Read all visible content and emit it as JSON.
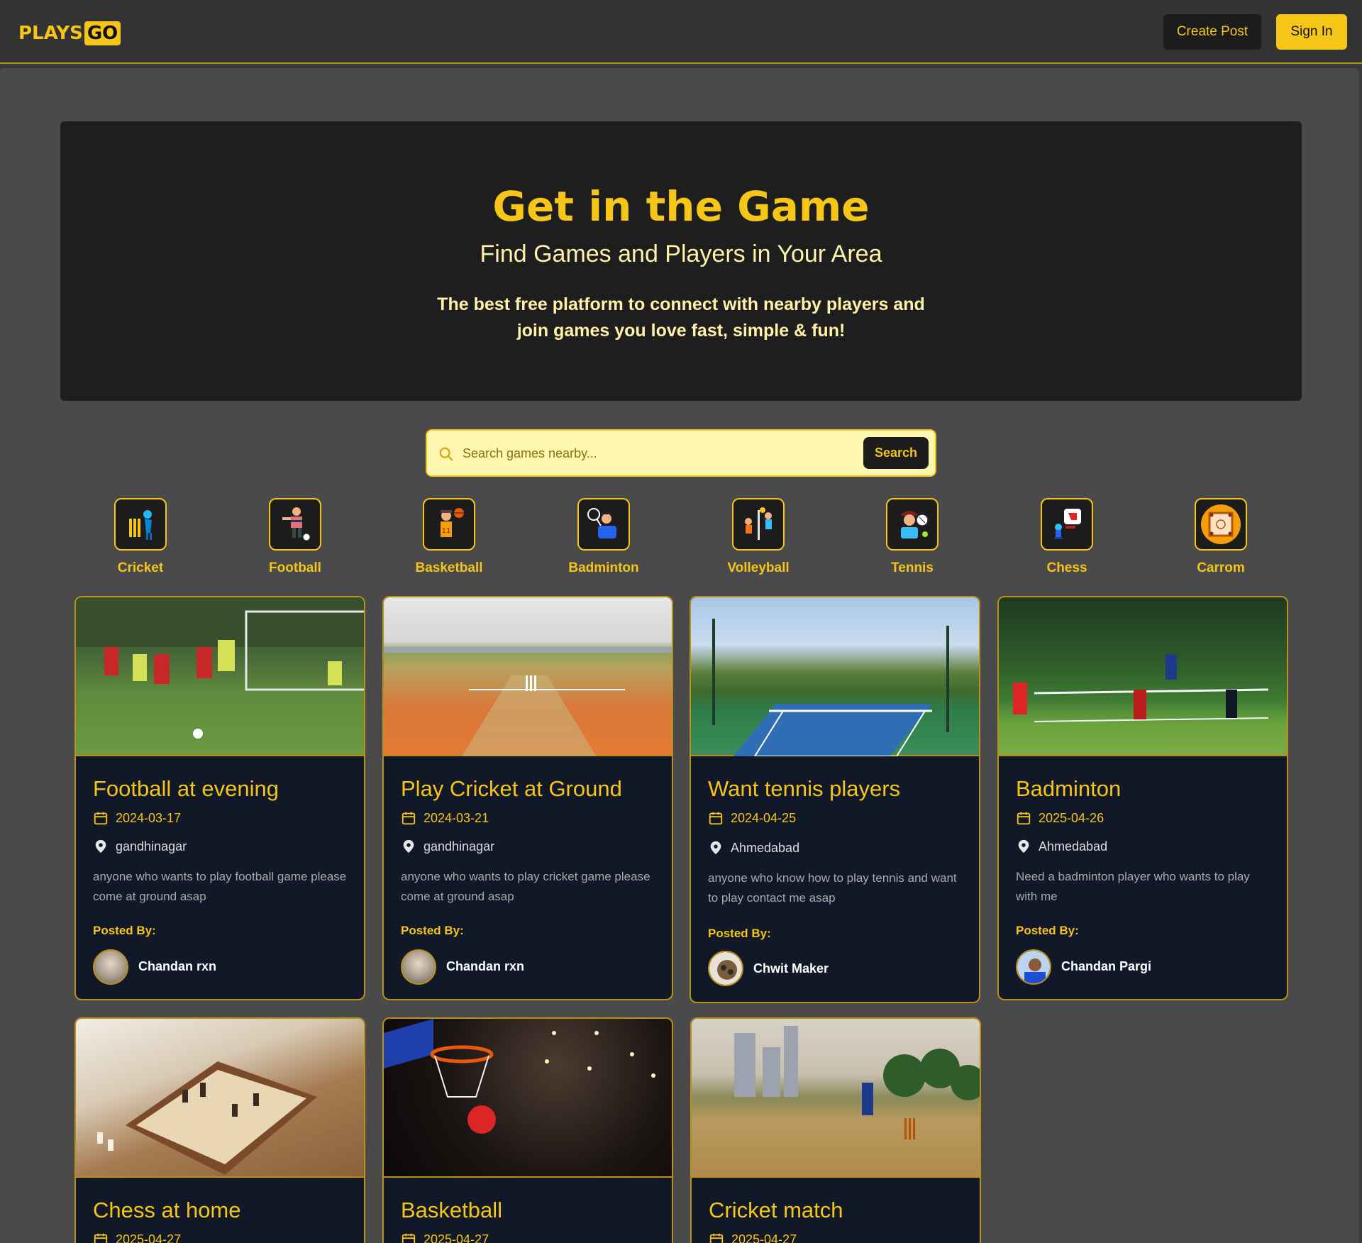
{
  "brand": {
    "part1": "PLAYS",
    "part2": "GO"
  },
  "header": {
    "create_post": "Create Post",
    "sign_in": "Sign In"
  },
  "hero": {
    "title": "Get in the Game",
    "subtitle": "Find Games and Players in Your Area",
    "description": "The best free platform to connect with nearby players and join games you love fast, simple & fun!"
  },
  "search": {
    "placeholder": "Search games nearby...",
    "button": "Search"
  },
  "categories": [
    {
      "label": "Cricket",
      "icon": "cricket-icon"
    },
    {
      "label": "Football",
      "icon": "football-icon"
    },
    {
      "label": "Basketball",
      "icon": "basketball-icon"
    },
    {
      "label": "Badminton",
      "icon": "badminton-icon"
    },
    {
      "label": "Volleyball",
      "icon": "volleyball-icon"
    },
    {
      "label": "Tennis",
      "icon": "tennis-icon"
    },
    {
      "label": "Chess",
      "icon": "chess-icon"
    },
    {
      "label": "Carrom",
      "icon": "carrom-icon"
    }
  ],
  "posted_by_label": "Posted By:",
  "posts": [
    {
      "title": "Football at evening",
      "date": "2024-03-17",
      "location": "gandhinagar",
      "description": "anyone who wants to play football game please come at ground asap",
      "author": "Chandan rxn"
    },
    {
      "title": "Play Cricket at Ground",
      "date": "2024-03-21",
      "location": "gandhinagar",
      "description": "anyone who wants to play cricket game please come at ground asap",
      "author": "Chandan rxn"
    },
    {
      "title": "Want tennis players",
      "date": "2024-04-25",
      "location": "Ahmedabad",
      "description": "anyone who know how to play tennis and want to play contact me asap",
      "author": "Chwit Maker"
    },
    {
      "title": "Badminton",
      "date": "2025-04-26",
      "location": "Ahmedabad",
      "description": "Need a badminton player who wants to play with me",
      "author": "Chandan Pargi"
    },
    {
      "title": "Chess at home",
      "date": "2025-04-27",
      "location": "",
      "description": "",
      "author": ""
    },
    {
      "title": "Basketball",
      "date": "2025-04-27",
      "location": "",
      "description": "",
      "author": ""
    },
    {
      "title": "Cricket match",
      "date": "2025-04-27",
      "location": "",
      "description": "",
      "author": ""
    }
  ],
  "colors": {
    "accent": "#f5c518",
    "card_bg": "#111827",
    "header_bg": "#333333",
    "hero_bg": "#1e1e1e"
  }
}
